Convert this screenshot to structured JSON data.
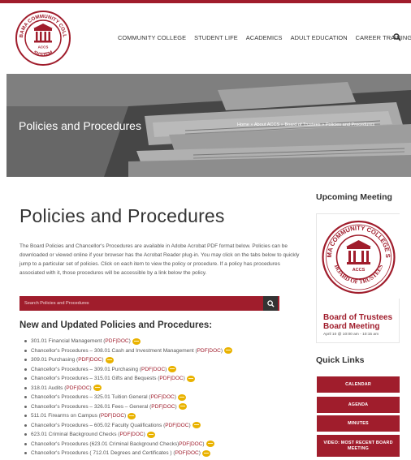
{
  "nav": {
    "items": [
      "COMMUNITY COLLEGE",
      "STUDENT LIFE",
      "ACADEMICS",
      "ADULT EDUCATION",
      "CAREER TRAINING"
    ]
  },
  "logo": {
    "top_text": "ALABAMA COMMUNITY COLLEGE",
    "bottom_text": "SYSTEM",
    "center_text": "ACCS"
  },
  "hero": {
    "title": "Policies and Procedures",
    "breadcrumb": "Home » About ACCS » Board of Trustees » Policies and Procedures"
  },
  "main": {
    "title": "Policies and Procedures",
    "intro": "The Board Policies and Chancellor's Procedures are available in Adobe Acrobat PDF format below. Policies can be downloaded or viewed online if your browser has the Acrobat Reader plug-in. You may click on the tabs below to quickly jump to a particular set of policies. Click on each item to view the policy or procedure. If a policy has procedures associated with it, those procedures will be accessible by a link below the policy.",
    "search_placeholder": "Search Policies and Procedures",
    "updated_heading": "New and Updated Policies and Procedures:",
    "pdf_label": "PDF",
    "doc_label": "DOC",
    "policies": [
      {
        "text": "301.01 Financial Management ( ",
        "style": "paren"
      },
      {
        "text": "Chancellor's Procedures – 308.01 Cash and Investment Management ( ",
        "style": "paren"
      },
      {
        "text": "309.01 Purchasing ( ",
        "style": "paren"
      },
      {
        "text": "Chancellor's Procedures – 309.01 Purchasing ( ",
        "style": "paren"
      },
      {
        "text": "Chancellor's Procedures – 315.01 Gifts and Bequests ( ",
        "style": "paren"
      },
      {
        "text": "318.01 Audits ( ",
        "style": "paren"
      },
      {
        "text": "Chancellor's Procedures – 325.01 Tuition General ( ",
        "style": "paren"
      },
      {
        "text": "Chancellor's Procedures – 326.01 Fees – General ( ",
        "style": "paren"
      },
      {
        "text": "511.01 Firearms on Campus ( ",
        "style": "paren"
      },
      {
        "text": "Chancellor's Procedures – 605.02 Faculty Qualifications ( ",
        "style": "paren"
      },
      {
        "text": "623.01 Criminal Background Checks ( ",
        "style": "paren"
      },
      {
        "text": "Chancellor's Procedures (623.01 Criminal Background Checks) ",
        "style": "plain"
      },
      {
        "text": "Chancellor's Procedures ( 712.01 Degrees and Certificates ) ( ",
        "style": "paren"
      }
    ]
  },
  "aside": {
    "upcoming_title": "Upcoming Meeting",
    "meeting_seal_top": "ALABAMA COMMUNITY COLLEGE SYSTEM",
    "meeting_seal_bottom": "BOARD OF TRUSTEES",
    "meeting_seal_center": "ACCS",
    "meeting_name": "Board of Trustees Board Meeting",
    "meeting_time": "April 10 @ 10:00 am - 10:15 am",
    "quick_title": "Quick Links",
    "links": [
      "CALENDAR",
      "AGENDA",
      "MINUTES",
      "VIDEO: MOST RECENT BOARD MEETING"
    ]
  },
  "colors": {
    "accent": "#a01d2c",
    "dark": "#333333",
    "badge": "#e9b200"
  }
}
